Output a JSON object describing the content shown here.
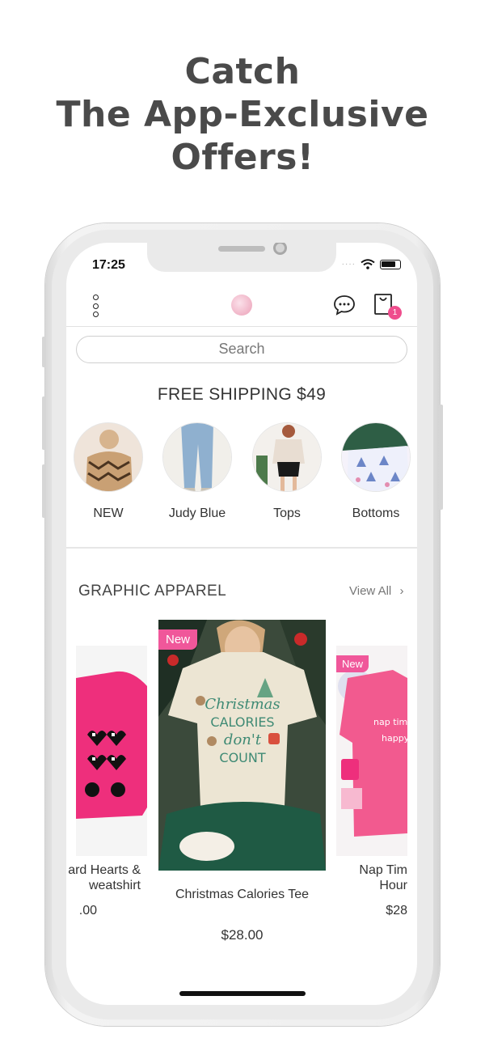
{
  "headline": [
    "Catch",
    "The App-Exclusive",
    "Offers!"
  ],
  "status_bar": {
    "time": "17:25",
    "dots": "····"
  },
  "header": {
    "cart_count": "1"
  },
  "search": {
    "placeholder": "Search"
  },
  "banner": {
    "text": "FREE SHIPPING $49"
  },
  "categories": [
    {
      "label": "NEW"
    },
    {
      "label": "Judy Blue"
    },
    {
      "label": "Tops"
    },
    {
      "label": "Bottoms"
    }
  ],
  "section": {
    "title": "GRAPHIC APPAREL",
    "view_all": "View All"
  },
  "products": [
    {
      "name_line1": "ard Hearts &",
      "name_line2": "weatshirt",
      "price": ".00"
    },
    {
      "badge": "New",
      "name": "Christmas Calories Tee",
      "price": "$28.00",
      "shirt_lines": [
        "Christmas",
        "CALORIES",
        "don't",
        "COUNT"
      ]
    },
    {
      "badge": "New",
      "name_line1": "Nap Tim",
      "name_line2": "Hour",
      "price": "$28",
      "shirt_lines": [
        "nap tim",
        "happy"
      ]
    }
  ],
  "colors": {
    "accent_pink": "#f0579a",
    "badge_pink": "#ef4d8d",
    "hot_pink_shirt": "#ee2f7c",
    "headline_gray": "#4a4a4a"
  }
}
